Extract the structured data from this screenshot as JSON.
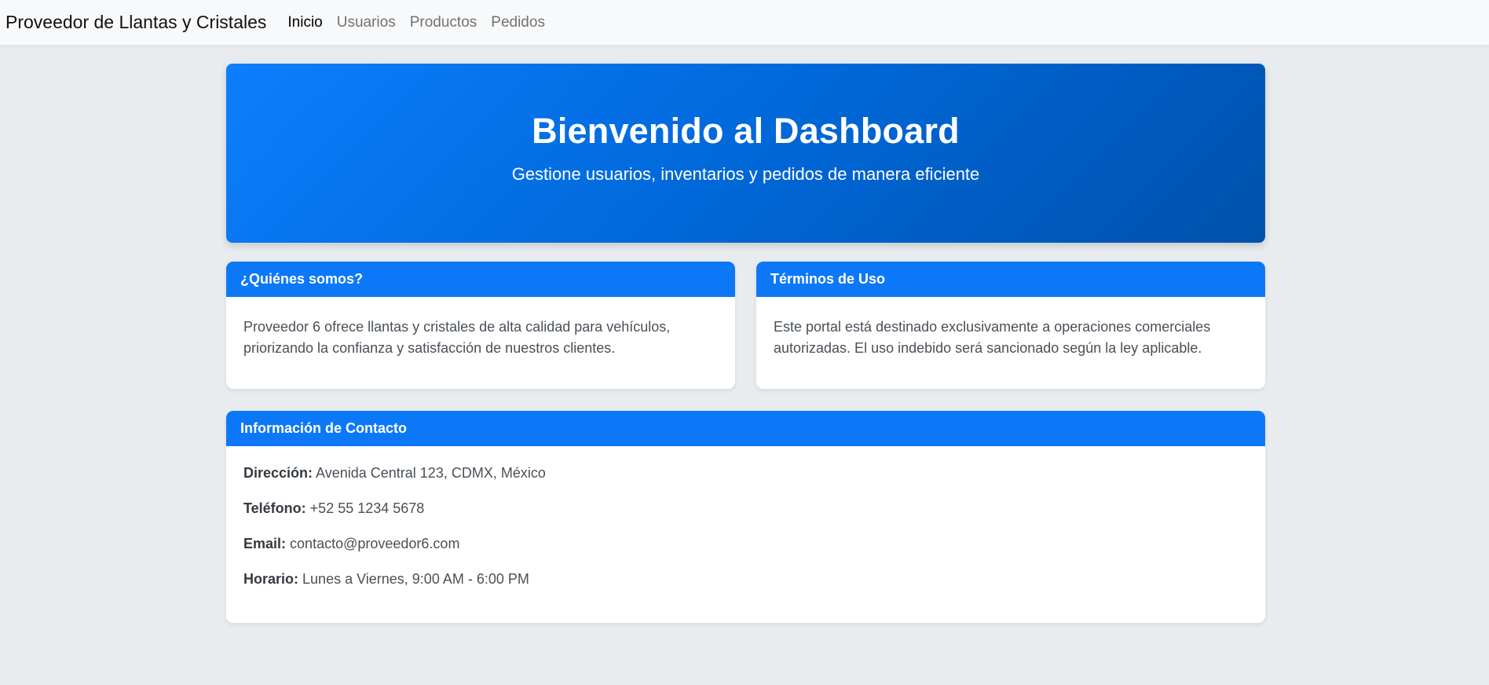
{
  "navbar": {
    "brand": "Proveedor de Llantas y Cristales",
    "links": [
      {
        "label": "Inicio",
        "active": true
      },
      {
        "label": "Usuarios",
        "active": false
      },
      {
        "label": "Productos",
        "active": false
      },
      {
        "label": "Pedidos",
        "active": false
      }
    ]
  },
  "hero": {
    "title": "Bienvenido al Dashboard",
    "subtitle": "Gestione usuarios, inventarios y pedidos de manera eficiente"
  },
  "about": {
    "title": "¿Quiénes somos?",
    "body": "Proveedor 6 ofrece llantas y cristales de alta calidad para vehículos, priorizando la confianza y satisfacción de nuestros clientes."
  },
  "terms": {
    "title": "Términos de Uso",
    "body": "Este portal está destinado exclusivamente a operaciones comerciales autorizadas. El uso indebido será sancionado según la ley aplicable."
  },
  "contact": {
    "title": "Información de Contacto",
    "items": [
      {
        "label": "Dirección:",
        "value": "Avenida Central 123, CDMX, México"
      },
      {
        "label": "Teléfono:",
        "value": "+52 55 1234 5678"
      },
      {
        "label": "Email:",
        "value": "contacto@proveedor6.com"
      },
      {
        "label": "Horario:",
        "value": "Lunes a Viernes, 9:00 AM - 6:00 PM"
      }
    ]
  },
  "colors": {
    "accent": "#0d78f7",
    "hero_gradient_start": "#0d7efc",
    "hero_gradient_end": "#0051ab",
    "page_background": "#e8ecef"
  }
}
